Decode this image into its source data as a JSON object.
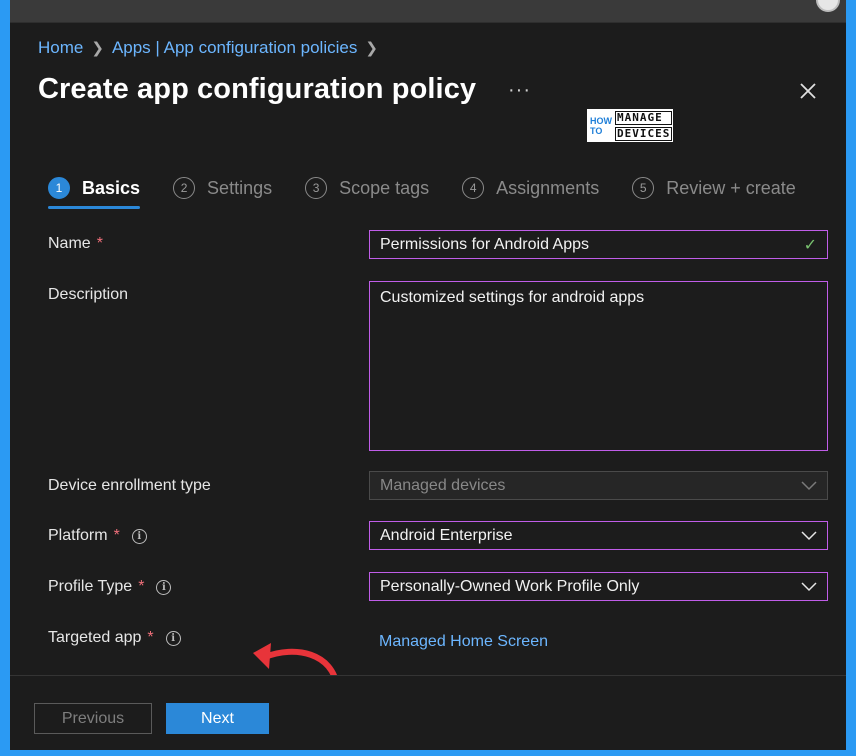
{
  "breadcrumb": [
    {
      "label": "Home"
    },
    {
      "label": "Apps | App configuration policies"
    }
  ],
  "title": "Create app configuration policy",
  "more_label": "···",
  "logo": {
    "how": "HOW",
    "to": "TO",
    "manage": "MANAGE",
    "devices": "DEVICES"
  },
  "steps": [
    {
      "num": "1",
      "label": "Basics",
      "active": true
    },
    {
      "num": "2",
      "label": "Settings"
    },
    {
      "num": "3",
      "label": "Scope tags"
    },
    {
      "num": "4",
      "label": "Assignments"
    },
    {
      "num": "5",
      "label": "Review + create"
    }
  ],
  "form": {
    "name": {
      "label": "Name",
      "required": "*",
      "value": "Permissions for Android Apps"
    },
    "description": {
      "label": "Description",
      "value": "Customized settings for android apps"
    },
    "enrollment": {
      "label": "Device enrollment type",
      "value": "Managed devices"
    },
    "platform": {
      "label": "Platform",
      "required": "*",
      "value": "Android Enterprise"
    },
    "profile_type": {
      "label": "Profile Type",
      "required": "*",
      "value": "Personally-Owned Work Profile Only"
    },
    "targeted_app": {
      "label": "Targeted app",
      "required": "*",
      "value": "Managed Home Screen"
    }
  },
  "footer": {
    "previous": "Previous",
    "next": "Next"
  },
  "colors": {
    "accent": "#2b88d8",
    "link": "#6cb6ff",
    "focus_border": "#c05de8",
    "required": "#f1707b",
    "annotation_arrow": "#e8343a"
  }
}
